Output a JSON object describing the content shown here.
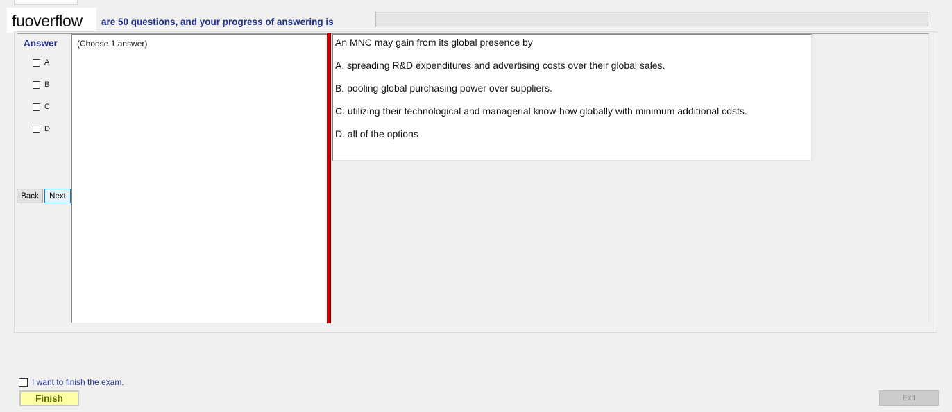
{
  "header": {
    "watermark": "fuoverflow",
    "progress_text": "are 50 questions, and your progress of answering is",
    "progress_value": 0
  },
  "answer_panel": {
    "heading": "Answer",
    "options": [
      "A",
      "B",
      "C",
      "D"
    ],
    "back_label": "Back",
    "next_label": "Next"
  },
  "left_pane": {
    "instruction": "(Choose 1 answer)"
  },
  "question": {
    "stem": "An MNC may gain from its global presence by",
    "choices": [
      "A.  spreading R&D expenditures and advertising costs over their global sales.",
      "B.  pooling global purchasing power over suppliers.",
      "C.  utilizing their technological and managerial know-how globally with minimum additional costs.",
      "D.  all of the options"
    ]
  },
  "footer": {
    "finish_checkbox_label": "I want to finish the exam.",
    "finish_label": "Finish",
    "exit_label": "Exit"
  },
  "colors": {
    "accent_text": "#1f2f8c",
    "splitter": "#cc0000",
    "finish_bg": "#ffffa6"
  }
}
